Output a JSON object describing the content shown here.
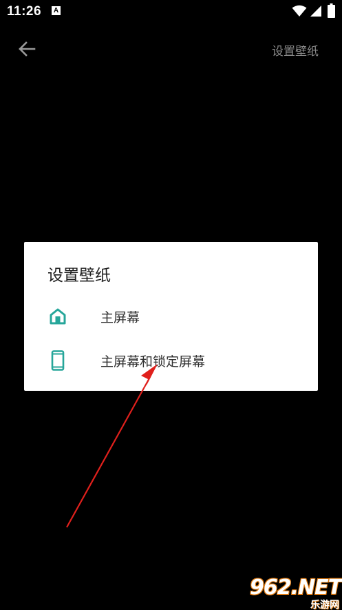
{
  "status_bar": {
    "time": "11:26",
    "app_icon_letter": "A",
    "icons": [
      "wifi-icon",
      "signal-icon",
      "battery-icon"
    ]
  },
  "top_bar": {
    "back_icon": "arrow-left-icon",
    "title": "设置壁纸"
  },
  "dialog": {
    "title": "设置壁纸",
    "options": [
      {
        "icon": "home-icon",
        "label": "主屏幕"
      },
      {
        "icon": "phone-icon",
        "label": "主屏幕和锁定屏幕"
      }
    ]
  },
  "watermark": {
    "brand": "962.NET",
    "sub": "乐游网"
  },
  "colors": {
    "background": "#000000",
    "dialog_bg": "#ffffff",
    "accent_icon": "#26a69a",
    "annotation_arrow": "#e0201c"
  }
}
